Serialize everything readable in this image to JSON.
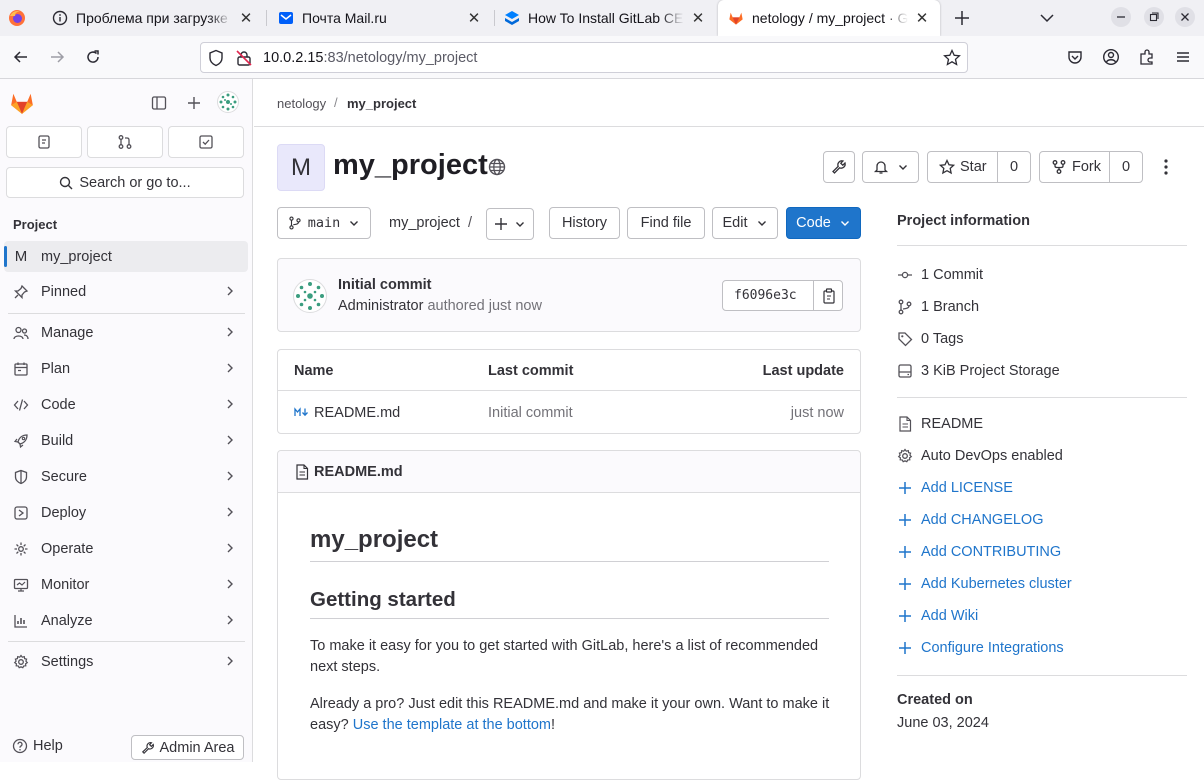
{
  "browser": {
    "tabs": [
      {
        "title": "Проблема при загрузке страницы",
        "icon": "info-icon"
      },
      {
        "title": "Почта Mail.ru",
        "icon": "mail-icon"
      },
      {
        "title": "How To Install GitLab CE on Ubuntu",
        "icon": "layers-icon"
      },
      {
        "title": "netology / my_project · GitLab",
        "icon": "gitlab-icon",
        "active": true
      }
    ],
    "url_host": "10.0.2.15",
    "url_rest": ":83/netology/my_project"
  },
  "sidebar": {
    "search_label": "Search or go to...",
    "section_title": "Project",
    "project_initial": "M",
    "project_name": "my_project",
    "items": [
      {
        "label": "Pinned",
        "icon": "pin-icon"
      },
      {
        "label": "Manage",
        "icon": "users-icon"
      },
      {
        "label": "Plan",
        "icon": "planning-icon"
      },
      {
        "label": "Code",
        "icon": "code-icon"
      },
      {
        "label": "Build",
        "icon": "rocket-icon"
      },
      {
        "label": "Secure",
        "icon": "shield-icon"
      },
      {
        "label": "Deploy",
        "icon": "deploy-icon"
      },
      {
        "label": "Operate",
        "icon": "cloud-gear-icon"
      },
      {
        "label": "Monitor",
        "icon": "monitor-icon"
      },
      {
        "label": "Analyze",
        "icon": "chart-icon"
      },
      {
        "label": "Settings",
        "icon": "gear-icon"
      }
    ],
    "help_label": "Help",
    "admin_label": "Admin Area"
  },
  "breadcrumb": {
    "group": "netology",
    "project": "my_project"
  },
  "project": {
    "initial": "M",
    "title": "my_project",
    "star_label": "Star",
    "star_count": "0",
    "fork_label": "Fork",
    "fork_count": "0"
  },
  "toolbar": {
    "branch": "main",
    "path": "my_project",
    "path_sep": "/",
    "history": "History",
    "find_file": "Find file",
    "edit": "Edit",
    "code": "Code"
  },
  "last_commit": {
    "title": "Initial commit",
    "author": "Administrator",
    "authored": "authored just now",
    "sha": "f6096e3c"
  },
  "files": {
    "headers": [
      "Name",
      "Last commit",
      "Last update"
    ],
    "rows": [
      {
        "name": "README.md",
        "commit": "Initial commit",
        "updated": "just now"
      }
    ]
  },
  "readme": {
    "filename": "README.md",
    "h1": "my_project",
    "h2": "Getting started",
    "p1": "To make it easy for you to get started with GitLab, here's a list of recommended next steps.",
    "p2a": "Already a pro? Just edit this README.md and make it your own. Want to make it easy? ",
    "p2link": "Use the template at the bottom",
    "p2b": "!"
  },
  "info": {
    "heading": "Project information",
    "stats": [
      {
        "icon": "commit-icon",
        "label": "1 Commit"
      },
      {
        "icon": "branch-icon",
        "label": "1 Branch"
      },
      {
        "icon": "tag-icon",
        "label": "0 Tags"
      },
      {
        "icon": "storage-icon",
        "label": "3 KiB Project Storage"
      }
    ],
    "links": [
      {
        "icon": "doc-icon",
        "label": "README",
        "link": false
      },
      {
        "icon": "settings-icon",
        "label": "Auto DevOps enabled",
        "link": false
      },
      {
        "icon": "plus-icon",
        "label": "Add LICENSE",
        "link": true
      },
      {
        "icon": "plus-icon",
        "label": "Add CHANGELOG",
        "link": true
      },
      {
        "icon": "plus-icon",
        "label": "Add CONTRIBUTING",
        "link": true
      },
      {
        "icon": "plus-icon",
        "label": "Add Kubernetes cluster",
        "link": true
      },
      {
        "icon": "plus-icon",
        "label": "Add Wiki",
        "link": true
      },
      {
        "icon": "plus-icon",
        "label": "Configure Integrations",
        "link": true
      }
    ],
    "created_heading": "Created on",
    "created_date": "June 03, 2024"
  }
}
